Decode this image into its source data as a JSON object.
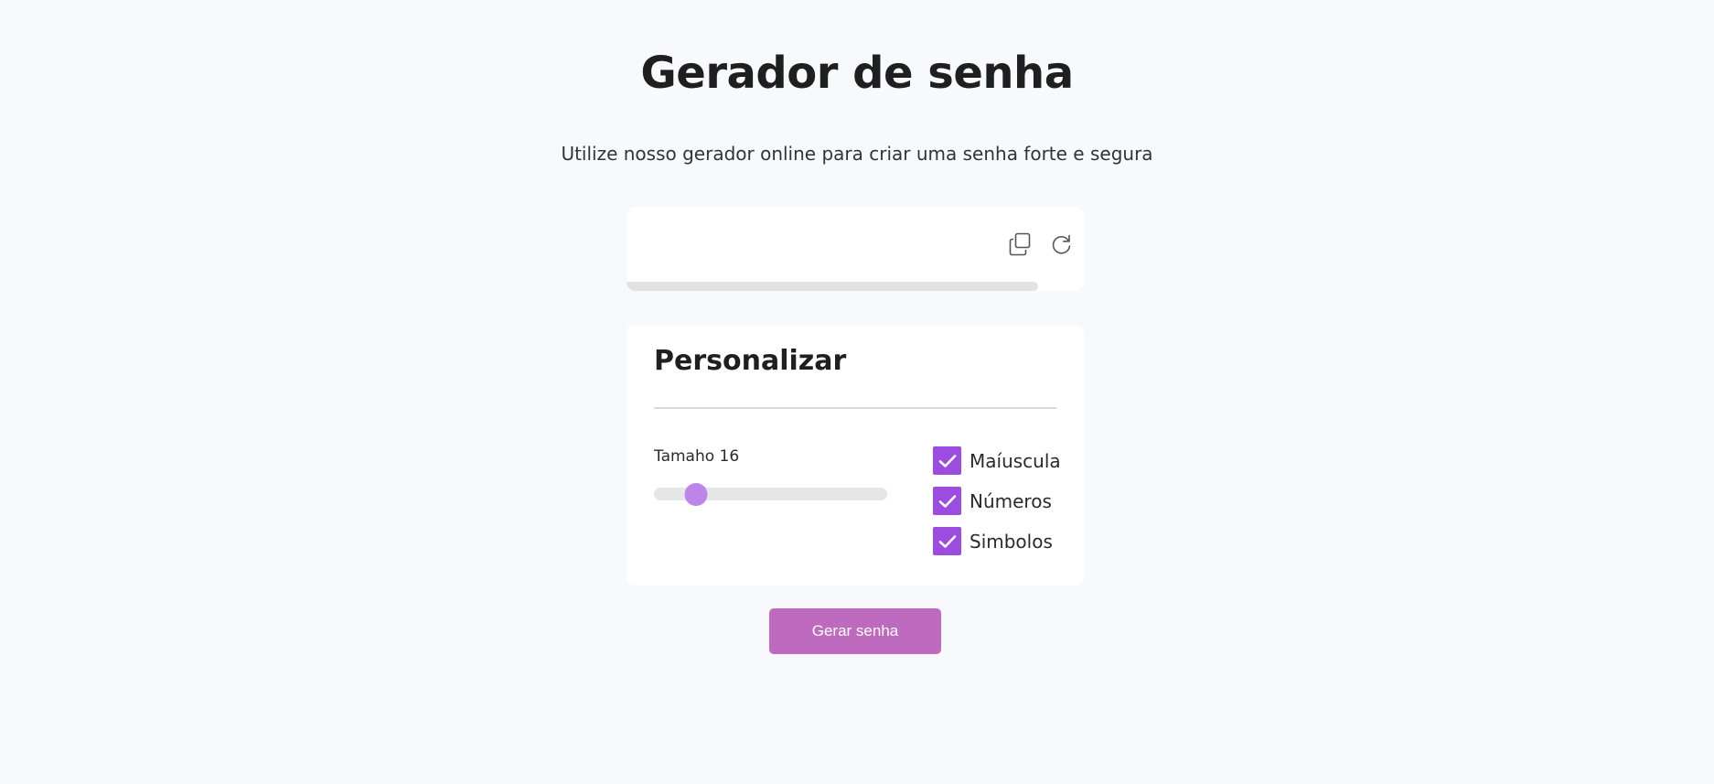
{
  "header": {
    "title": "Gerador de senha",
    "subtitle": "Utilize nosso gerador online para criar uma senha forte e segura"
  },
  "password": {
    "value": "",
    "copy_icon": "copy-icon",
    "refresh_icon": "refresh-icon",
    "strength_fraction": 0.9
  },
  "customize": {
    "title": "Personalizar",
    "length_label": "Tamaho 16",
    "length": {
      "value": 16,
      "fraction": 0.18
    },
    "options": [
      {
        "label": "Maíuscula",
        "checked": true
      },
      {
        "label": "Números",
        "checked": true
      },
      {
        "label": "Simbolos",
        "checked": true
      }
    ]
  },
  "actions": {
    "generate_label": "Gerar senha"
  },
  "colors": {
    "background": "#f8f9fc",
    "accent": "#9c4ddf",
    "slider_thumb": "#bd85e8",
    "button": "#bd6abf",
    "strength_bar": "#e2e2e2"
  }
}
